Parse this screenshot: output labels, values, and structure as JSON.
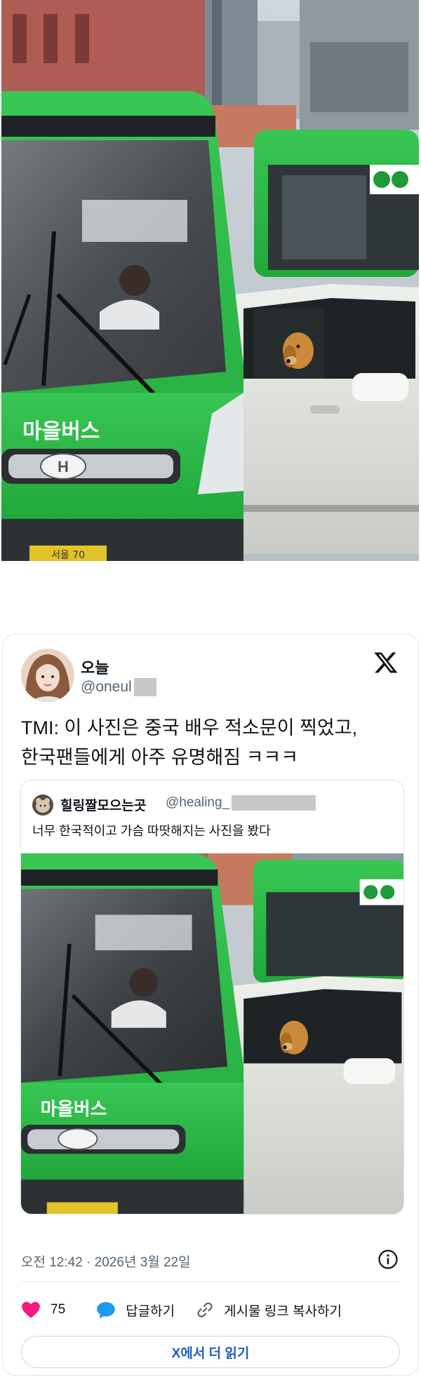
{
  "tweet": {
    "display_name": "오늘",
    "handle": "@oneul",
    "text_lines": [
      "TMI: 이 사진은 중국 배우 적소문이 찍었고,",
      "한국팬들에게 아주 유명해짐 ㅋㅋㅋ"
    ],
    "timestamp": "오전 12:42 · 2026년 3월 22일",
    "icons": {
      "logo": "x-logo-icon",
      "info": "info-icon",
      "like": "heart-icon",
      "reply": "reply-bubble-icon",
      "link": "link-icon"
    },
    "colors": {
      "like": "#f91880",
      "reply": "#1d9bf0",
      "read_more": "#1d5fb8"
    }
  },
  "quote": {
    "display_name": "힐링짤모으는곳",
    "handle": "@healing_",
    "text": "너무 한국적이고 가슴 따땃해지는 사진을 봤다"
  },
  "actions": {
    "like_count": "75",
    "reply_label": "답글하기",
    "copy_link_label": "게시물 링크 복사하기"
  },
  "read_more_label": "X에서 더 읽기",
  "photo": {
    "bus_text": "마을버스",
    "plate_text": "서울 70"
  }
}
